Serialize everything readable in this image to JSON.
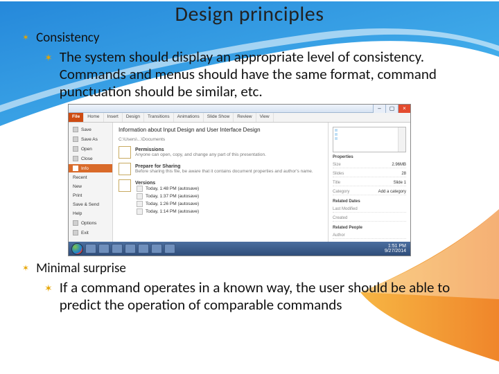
{
  "title": "Design principles",
  "b1": {
    "label": "Consistency",
    "desc": "The system should display an appropriate level of consistency. Commands and menus should have the same format, command punctuation should be similar, etc."
  },
  "b2": {
    "label": "Minimal surprise",
    "desc": "If a command operates in a known way, the user should be able to predict the operation of comparable commands"
  },
  "shot": {
    "tabs": {
      "file": "File",
      "home": "Home",
      "insert": "Insert",
      "design": "Design",
      "trans": "Transitions",
      "anim": "Animations",
      "ss": "Slide Show",
      "review": "Review",
      "view": "View"
    },
    "nav": {
      "save": "Save",
      "saveas": "Save As",
      "open": "Open",
      "close": "Close",
      "info": "Info",
      "recent": "Recent",
      "new": "New",
      "print": "Print",
      "share": "Save & Send",
      "help": "Help",
      "options": "Options",
      "exit": "Exit"
    },
    "info": {
      "heading": "Information about Input Design and User Interface Design",
      "path": "C:\\Users\\...\\Documents",
      "perm_t": "Permissions",
      "perm_d": "Anyone can open, copy, and change any part of this presentation.",
      "prep_t": "Prepare for Sharing",
      "prep_d": "Before sharing this file, be aware that it contains document properties and author's name.",
      "ver_t": "Versions",
      "ver1": "Today, 1:48 PM (autosave)",
      "ver2": "Today, 1:37 PM (autosave)",
      "ver3": "Today, 1:26 PM (autosave)",
      "ver4": "Today, 1:14 PM (autosave)"
    },
    "props": {
      "h": "Properties",
      "size_k": "Size",
      "size_v": "2.96MB",
      "slides_k": "Slides",
      "slides_v": "28",
      "title_k": "Title",
      "title_v": "Slide 1",
      "cat_k": "Category",
      "cat_v": "Add a category",
      "rel_h": "Related Dates",
      "mod_k": "Last Modified",
      "created_k": "Created",
      "rel_p": "Related People",
      "auth_k": "Author"
    },
    "clock": {
      "time": "1:51 PM",
      "date": "9/27/2014"
    }
  }
}
